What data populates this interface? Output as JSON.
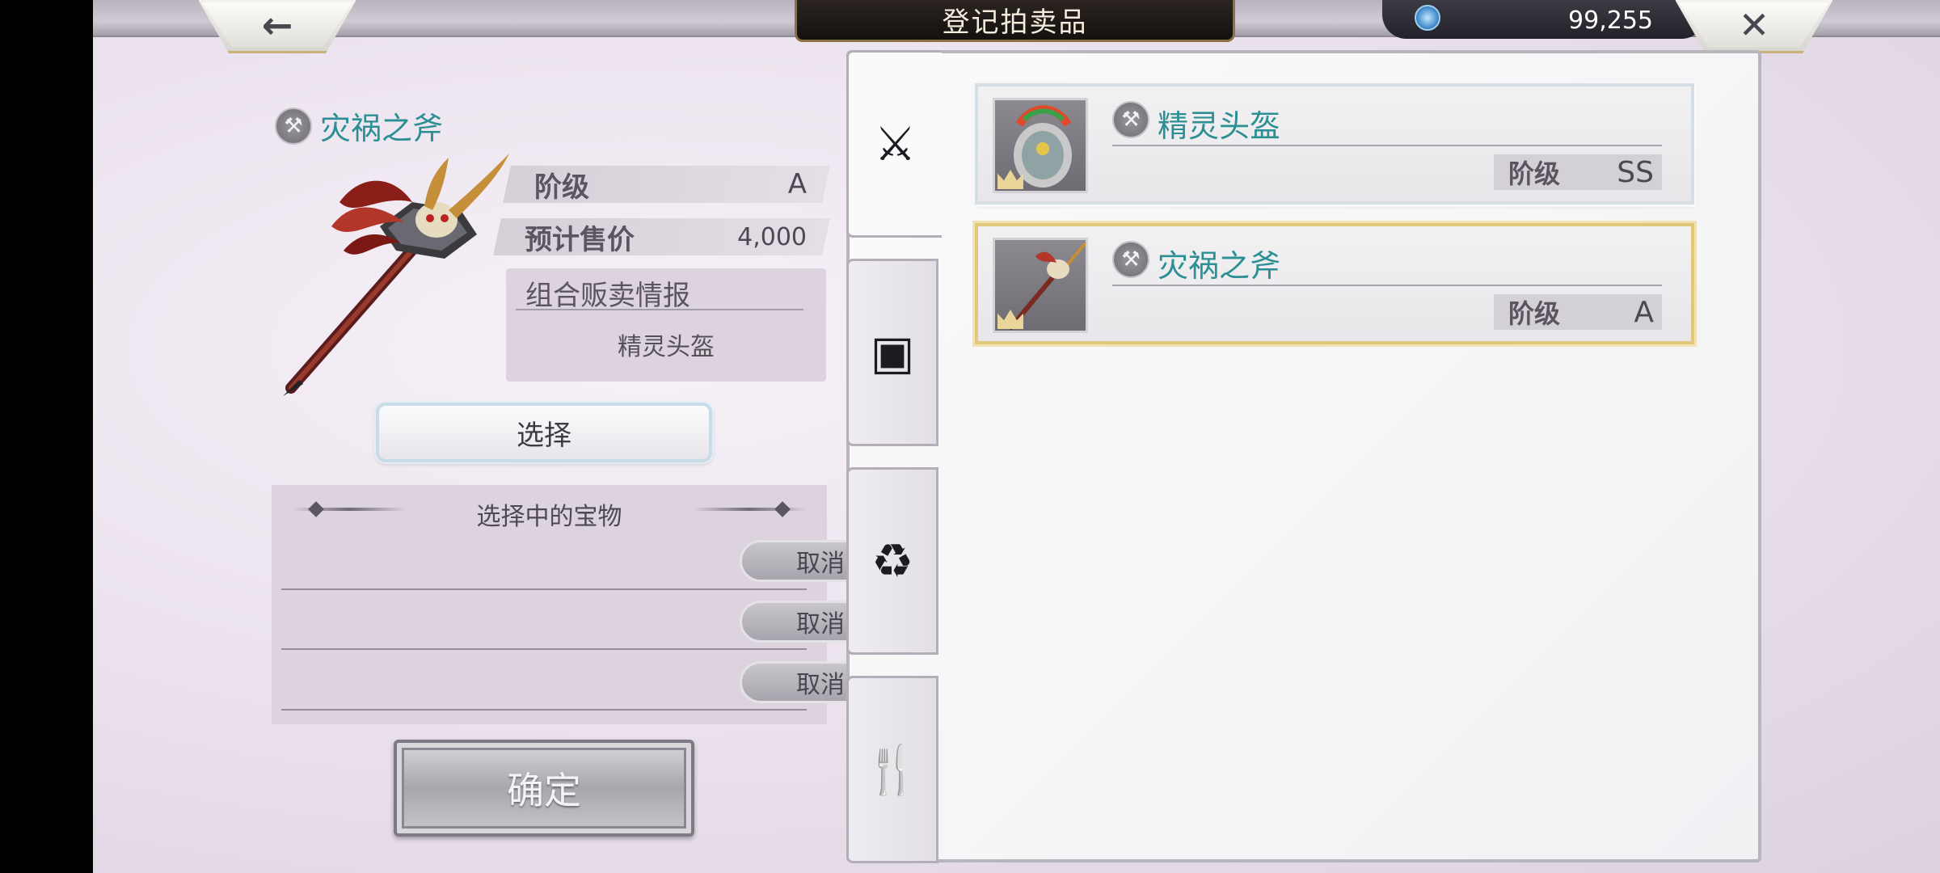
{
  "header": {
    "title": "登记拍卖品",
    "back_icon": "←",
    "close_icon": "✕",
    "currency_value": "99,255"
  },
  "detail": {
    "item_name": "灾祸之斧",
    "grade_label": "阶级",
    "grade_value": "A",
    "price_label": "预计售价",
    "price_value": "4,000",
    "combo_title": "组合贩卖情报",
    "combo_item": "精灵头盔",
    "select_label": "选择"
  },
  "selection": {
    "title": "选择中的宝物",
    "cancel_labels": [
      "取消",
      "取消",
      "取消"
    ]
  },
  "confirm_label": "确定",
  "tabs": [
    {
      "name": "weapon-tab",
      "icon": "weapon-shield-icon"
    },
    {
      "name": "armor-tab",
      "icon": "frame-icon"
    },
    {
      "name": "accessory-tab",
      "icon": "bag-icon"
    },
    {
      "name": "food-tab",
      "icon": "cutlery-icon"
    }
  ],
  "items": [
    {
      "name": "精灵头盔",
      "grade_label": "阶级",
      "grade_value": "SS",
      "selected": false
    },
    {
      "name": "灾祸之斧",
      "grade_label": "阶级",
      "grade_value": "A",
      "selected": true
    }
  ],
  "colors": {
    "item_name": "#2b8f93",
    "selected_border": "#e0c77b"
  }
}
